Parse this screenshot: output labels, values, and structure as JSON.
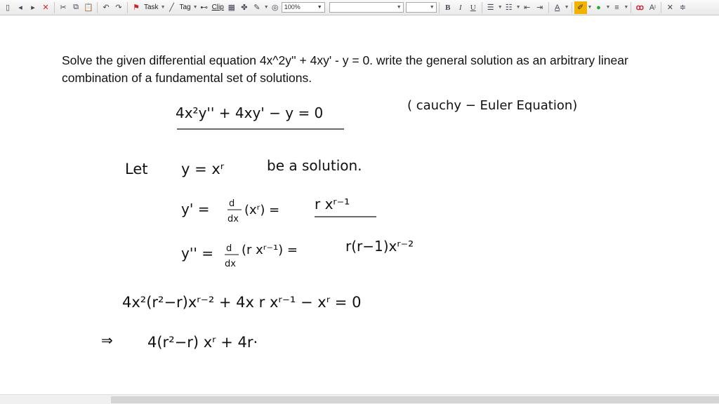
{
  "toolbar": {
    "task_label": "Task",
    "tag_label": "Tag",
    "clip_label": "Clip",
    "zoom_value": "100%",
    "font_bold": "B",
    "font_italic": "I",
    "font_underline": "U",
    "text_color_label": "A",
    "size_label": "A",
    "accent_color": "#f2b300",
    "highlight_color": "#f2b300",
    "fill_color": "#22aa33"
  },
  "problem": {
    "text": "Solve the given differential  equation 4x^2y'' + 4xy' - y = 0. write the general solution as an arbitrary linear combination  of a fundamental set of solutions."
  },
  "handwriting": {
    "equation": "4x²y'' + 4xy' − y = 0",
    "equation_note": "( cauchy − Euler Equation)",
    "let_word": "Let",
    "let_expr": "y = xʳ",
    "let_rest": "be a solution.",
    "dy_lhs": "y' = ",
    "dy_mid": "(xʳ) = ",
    "dy_rhs": "r xʳ⁻¹",
    "d2y_lhs": "y'' = ",
    "d2y_mid": "(r xʳ⁻¹) = ",
    "d2y_rhs": "r(r−1)xʳ⁻²",
    "sub_line": "4x²(r²−r)xʳ⁻² + 4x r xʳ⁻¹ − xʳ = 0",
    "implies": "⇒",
    "last_line": "4(r²−r) xʳ + 4r·"
  }
}
